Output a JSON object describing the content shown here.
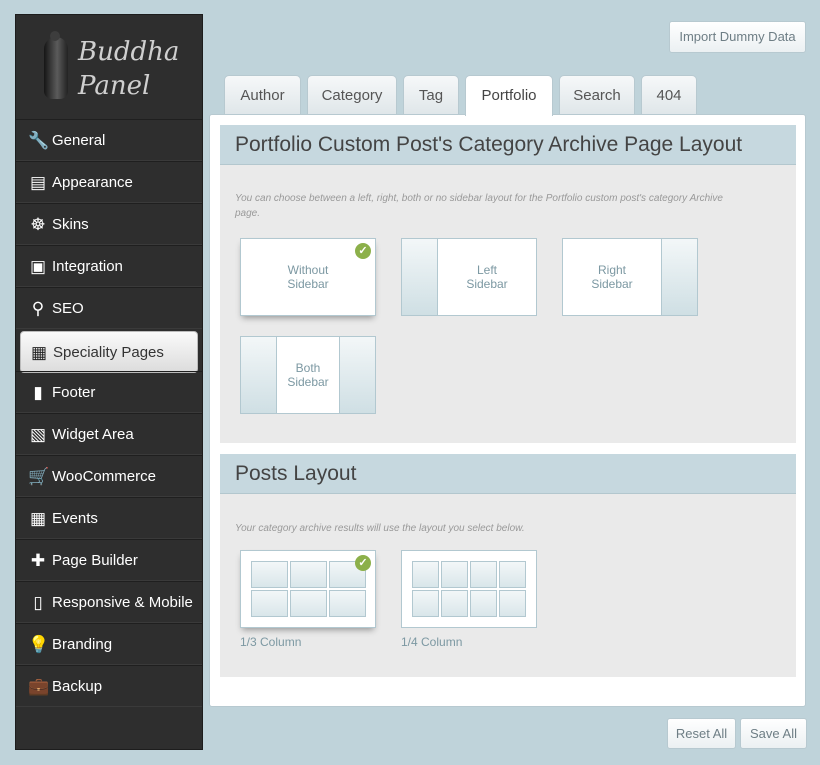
{
  "logo": {
    "line1": "Buddha",
    "line2": "Panel"
  },
  "sidebar": {
    "items": [
      {
        "label": "General",
        "icon": "wrench-icon"
      },
      {
        "label": "Appearance",
        "icon": "layout-icon"
      },
      {
        "label": "Skins",
        "icon": "helm-icon"
      },
      {
        "label": "Integration",
        "icon": "window-cursor-icon"
      },
      {
        "label": "SEO",
        "icon": "search-icon"
      },
      {
        "label": "Speciality Pages",
        "icon": "grid-icon"
      },
      {
        "label": "Footer",
        "icon": "footer-icon"
      },
      {
        "label": "Widget Area",
        "icon": "widget-icon"
      },
      {
        "label": "WooCommerce",
        "icon": "cart-icon"
      },
      {
        "label": "Events",
        "icon": "calendar-icon"
      },
      {
        "label": "Page Builder",
        "icon": "page-add-icon"
      },
      {
        "label": "Responsive & Mobile",
        "icon": "tablet-icon"
      },
      {
        "label": "Branding",
        "icon": "lightbulb-icon"
      },
      {
        "label": "Backup",
        "icon": "briefcase-icon"
      }
    ],
    "active": "Speciality Pages"
  },
  "toolbar": {
    "import_label": "Import Dummy Data",
    "reset_label": "Reset All",
    "save_label": "Save All"
  },
  "tabs": [
    {
      "label": "Author"
    },
    {
      "label": "Category"
    },
    {
      "label": "Tag"
    },
    {
      "label": "Portfolio"
    },
    {
      "label": "Search"
    },
    {
      "label": "404"
    }
  ],
  "active_tab": "Portfolio",
  "section1": {
    "title": "Portfolio Custom Post's Category Archive Page Layout",
    "desc_line1": "You can choose between a left, right, both or no sidebar layout for the Portfolio custom post's category Archive",
    "desc_line2": "page.",
    "options": [
      {
        "line1": "Without",
        "line2": "Sidebar",
        "selected": true
      },
      {
        "line1": "Left",
        "line2": "Sidebar",
        "selected": false
      },
      {
        "line1": "Right",
        "line2": "Sidebar",
        "selected": false
      },
      {
        "line1": "Both",
        "line2": "Sidebar",
        "selected": false
      }
    ]
  },
  "section2": {
    "title": "Posts Layout",
    "desc": "Your category archive results will use the layout you select below.",
    "options": [
      {
        "label": "1/3 Column",
        "selected": true
      },
      {
        "label": "1/4 Column",
        "selected": false
      }
    ]
  },
  "colors": {
    "sidebar_bg": "#2e2e2e",
    "page_bg": "#bfd3da",
    "header_bg": "#c6d8df",
    "check_green": "#8cb04a",
    "accent_text": "#7c98a2"
  }
}
